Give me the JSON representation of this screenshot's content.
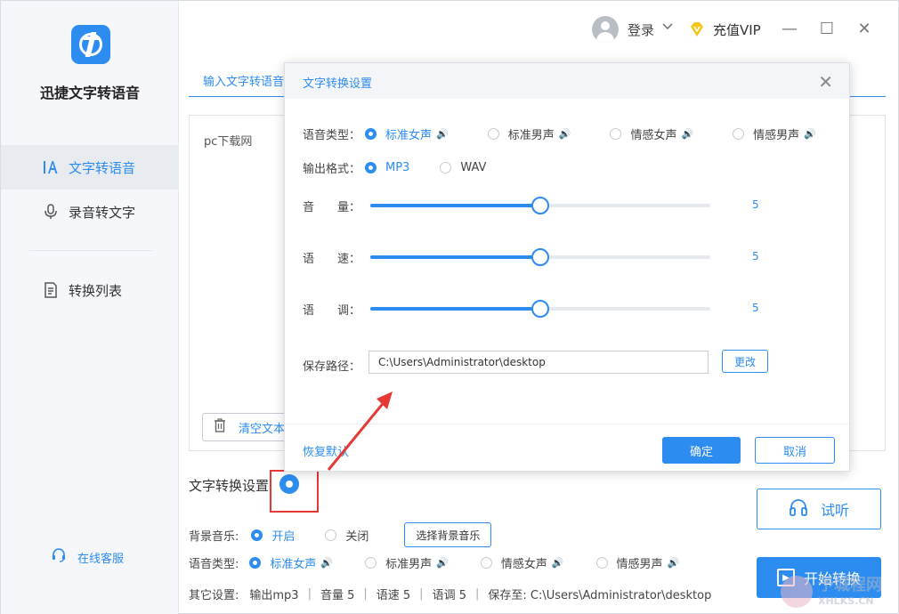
{
  "app": {
    "name": "迅捷文字转语音"
  },
  "sidebar": {
    "items": [
      {
        "label": "文字转语音",
        "icon": "text-a-icon"
      },
      {
        "label": "录音转文字",
        "icon": "microphone-icon"
      },
      {
        "label": "转换列表",
        "icon": "list-doc-icon"
      }
    ],
    "service": "在线客服"
  },
  "topbar": {
    "login": "登录",
    "vip": "充值VIP",
    "min": "—",
    "max": "☐",
    "close": "✕"
  },
  "main": {
    "tab_label": "输入文字转语音",
    "text_content": "pc下载网",
    "clear_label": "清空文本",
    "settings_title": "文字转换设置",
    "bg_music_label": "背景音乐:",
    "bg_music_on": "开启",
    "bg_music_off": "关闭",
    "bg_music_button": "选择背景音乐",
    "voice_label": "语音类型:",
    "voices": [
      "标准女声",
      "标准男声",
      "情感女声",
      "情感男声"
    ],
    "other_label": "其它设置:",
    "other_items": [
      "输出mp3",
      "音量 5",
      "语速 5",
      "语调 5",
      "保存至: C:\\Users\\Administrator\\desktop"
    ],
    "listen_label": "试听",
    "start_label": "开始转换"
  },
  "dialog": {
    "title": "文字转换设置",
    "close": "✕",
    "voice_label": "语音类型：",
    "voices": [
      "标准女声",
      "标准男声",
      "情感女声",
      "情感男声"
    ],
    "selected_voice": "标准女声",
    "format_label": "输出格式：",
    "formats": [
      "MP3",
      "WAV"
    ],
    "selected_format": "MP3",
    "sliders": [
      {
        "label": "音　　量：",
        "value": "5",
        "fraction": 0.5
      },
      {
        "label": "语　　速：",
        "value": "5",
        "fraction": 0.5
      },
      {
        "label": "语　　调：",
        "value": "5",
        "fraction": 0.5
      }
    ],
    "path_label": "保存路径：",
    "path_value": "C:\\Users\\Administrator\\desktop",
    "change_label": "更改",
    "reset_label": "恢复默认",
    "ok_label": "确定",
    "cancel_label": "取消"
  },
  "watermark": {
    "big": "予城程网",
    "small": "XHLKS.CN"
  },
  "colors": {
    "accent": "#2c8cf0",
    "annotation": "#e53935"
  }
}
